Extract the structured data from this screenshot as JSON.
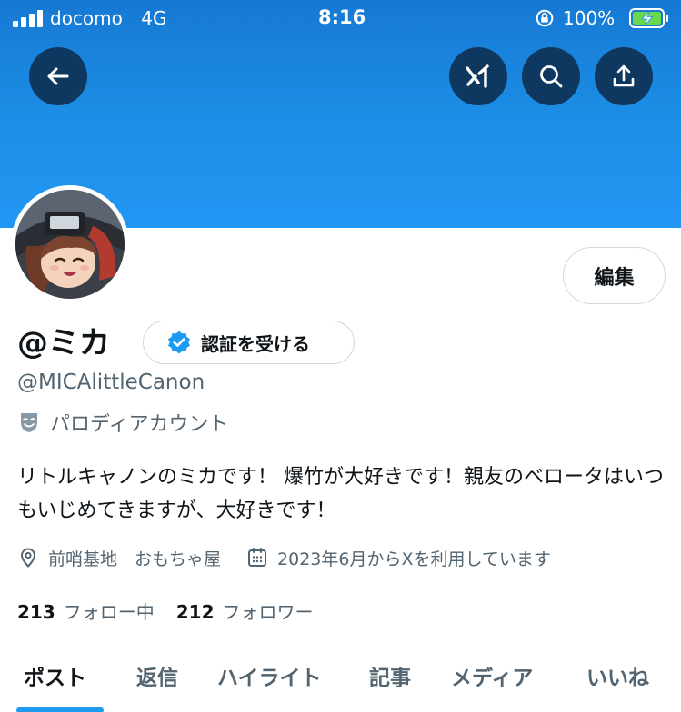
{
  "status_bar": {
    "carrier": "docomo",
    "network": "4G",
    "time": "8:16",
    "battery_percent": "100%"
  },
  "header": {
    "back_icon": "arrow-left-icon",
    "grok_icon": "grok-icon",
    "search_icon": "search-icon",
    "share_icon": "share-icon",
    "banner_color": "#1d8fe6"
  },
  "profile": {
    "display_name": "@ミカ",
    "verify_button_label": "認証を受ける",
    "handle": "@MICAlittleCanon",
    "parody_label": "パロディアカウント",
    "bio": "リトルキャノンのミカです！ 爆竹が大好きです！親友のベロータはいつもいじめてきますが、大好きです！",
    "location": "前哨基地　おもちゃ屋",
    "joined": "2023年6月からXを利用しています",
    "following_count": "213",
    "following_label": "フォロー中",
    "followers_count": "212",
    "followers_label": "フォロワー",
    "edit_button_label": "編集"
  },
  "tabs": [
    {
      "label": "ポスト",
      "active": true
    },
    {
      "label": "返信",
      "active": false
    },
    {
      "label": "ハイライト",
      "active": false
    },
    {
      "label": "記事",
      "active": false
    },
    {
      "label": "メディア",
      "active": false
    },
    {
      "label": "いいね",
      "active": false
    }
  ],
  "colors": {
    "accent": "#1d9bf0",
    "text_primary": "#0f1419",
    "text_secondary": "#536471",
    "header_button": "#0f3860"
  }
}
